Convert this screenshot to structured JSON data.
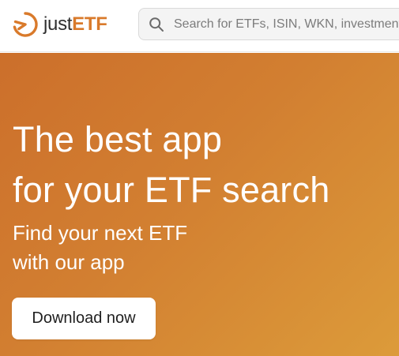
{
  "header": {
    "logo": {
      "text_just": "just",
      "text_etf": "ETF",
      "icon": "justetf-logo-icon",
      "brand_color": "#d97a2b"
    },
    "search": {
      "placeholder": "Search for ETFs, ISIN, WKN, investment themes",
      "value": "",
      "icon": "search-icon"
    }
  },
  "hero": {
    "title_line1": "The best app",
    "title_line2": "for your ETF search",
    "subtitle_line1": "Find your next ETF",
    "subtitle_line2": "with our app",
    "cta_label": "Download now",
    "background_colors": [
      "#cc6f2b",
      "#dc9b3a"
    ]
  }
}
